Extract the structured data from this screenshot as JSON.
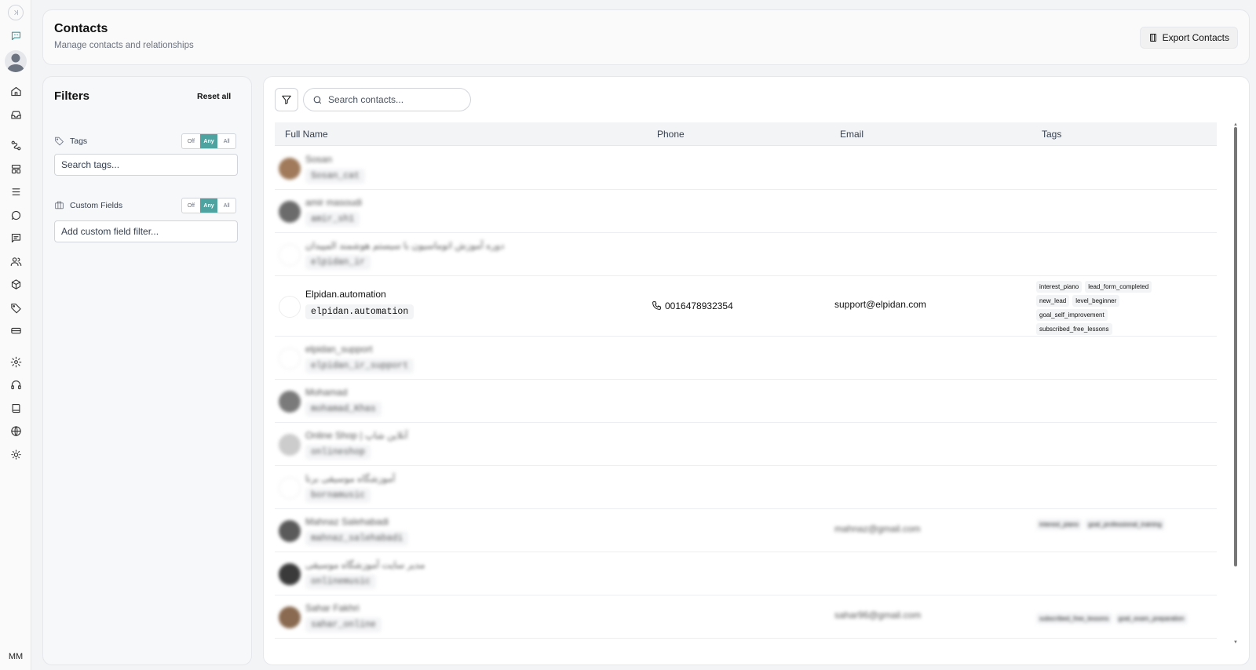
{
  "rail": {
    "items": [
      {
        "name": "collapse-sidebar-icon",
        "icon": "chevron-right-bar"
      },
      {
        "name": "chat-bot-icon",
        "icon": "message-bot"
      },
      {
        "name": "user-avatar",
        "icon": "avatar"
      },
      {
        "name": "home-icon",
        "icon": "home"
      },
      {
        "name": "inbox-icon",
        "icon": "inbox"
      },
      {
        "name": "workflow-icon",
        "icon": "route"
      },
      {
        "name": "templates-icon",
        "icon": "layout"
      },
      {
        "name": "list-icon",
        "icon": "list"
      },
      {
        "name": "chat-icon",
        "icon": "message-circle"
      },
      {
        "name": "messages-icon",
        "icon": "message-square"
      },
      {
        "name": "contacts-icon",
        "icon": "users"
      },
      {
        "name": "products-icon",
        "icon": "package"
      },
      {
        "name": "tags-icon",
        "icon": "tag"
      },
      {
        "name": "tickets-icon",
        "icon": "card"
      },
      {
        "name": "settings-icon",
        "icon": "gear"
      },
      {
        "name": "support-icon",
        "icon": "headphones"
      },
      {
        "name": "docs-icon",
        "icon": "book"
      },
      {
        "name": "language-icon",
        "icon": "globe"
      },
      {
        "name": "theme-icon",
        "icon": "sun"
      }
    ],
    "user_initials": "MM"
  },
  "header": {
    "title": "Contacts",
    "subtitle": "Manage contacts and relationships",
    "export_label": "Export Contacts"
  },
  "filters": {
    "title": "Filters",
    "reset_label": "Reset all",
    "tags": {
      "label": "Tags",
      "modes": [
        "Off",
        "Any",
        "All"
      ],
      "selected": "Any",
      "placeholder": "Search tags..."
    },
    "custom_fields": {
      "label": "Custom Fields",
      "modes": [
        "Off",
        "Any",
        "All"
      ],
      "selected": "Any",
      "placeholder": "Add custom field filter..."
    }
  },
  "main": {
    "search_placeholder": "Search contacts...",
    "columns": [
      "Full Name",
      "Phone",
      "Email",
      "Tags"
    ],
    "rows": [
      {
        "name": "Sosan",
        "username": "Sosan_cat",
        "phone": "",
        "email": "",
        "tags": [],
        "blurred": true,
        "avatar_color": "#a07a5a"
      },
      {
        "name": "amir masoudi",
        "username": "amir_sh1",
        "phone": "",
        "email": "",
        "tags": [],
        "blurred": true,
        "avatar_color": "#6b6b6b"
      },
      {
        "name": "دوره آموزش اتوماسیون با سیستم هوشمند المپیدان",
        "username": "elpidan_ir",
        "phone": "",
        "email": "",
        "tags": [],
        "blurred": true,
        "avatar_color": "#ffffff"
      },
      {
        "name": "Elpidan.automation",
        "username": "elpidan.automation",
        "phone": "0016478932354",
        "email": "support@elpidan.com",
        "tags": [
          "interest_piano",
          "lead_form_completed",
          "new_lead",
          "level_beginner",
          "goal_self_improvement",
          "subscribed_free_lessons"
        ],
        "blurred": false,
        "avatar_color": "#ffffff"
      },
      {
        "name": "elpidan_support",
        "username": "elpidan_ir_support",
        "phone": "",
        "email": "",
        "tags": [],
        "blurred": true,
        "avatar_color": "#ffffff"
      },
      {
        "name": "Mohamad",
        "username": "mohamad_Khas",
        "phone": "",
        "email": "",
        "tags": [],
        "blurred": true,
        "avatar_color": "#7a7a7a"
      },
      {
        "name": "Online Shop | آنلاین شاپ",
        "username": "onlineshop",
        "phone": "",
        "email": "",
        "tags": [],
        "blurred": true,
        "avatar_color": "#cccccc"
      },
      {
        "name": "آموزشگاه موسیقی برنا",
        "username": "bornamusic",
        "phone": "",
        "email": "",
        "tags": [],
        "blurred": true,
        "avatar_color": "#ffffff"
      },
      {
        "name": "Mahnaz Salehabadi",
        "username": "mahnaz_salehabadi",
        "phone": "",
        "email": "mahnaz@gmail.com",
        "tags": [
          "interest_piano",
          "goal_professional_training"
        ],
        "blurred": true,
        "avatar_color": "#5a5a5a"
      },
      {
        "name": "مدیر سایت آموزشگاه موسیقی",
        "username": "onlinemusic",
        "phone": "",
        "email": "",
        "tags": [],
        "blurred": true,
        "avatar_color": "#3a3a3a"
      },
      {
        "name": "Sahar Fakhri",
        "username": "sahar_online",
        "phone": "",
        "email": "sahar96@gmail.com",
        "tags": [
          "subscribed_free_lessons",
          "goal_exam_preparation"
        ],
        "blurred": true,
        "avatar_color": "#8a6a50"
      }
    ]
  }
}
